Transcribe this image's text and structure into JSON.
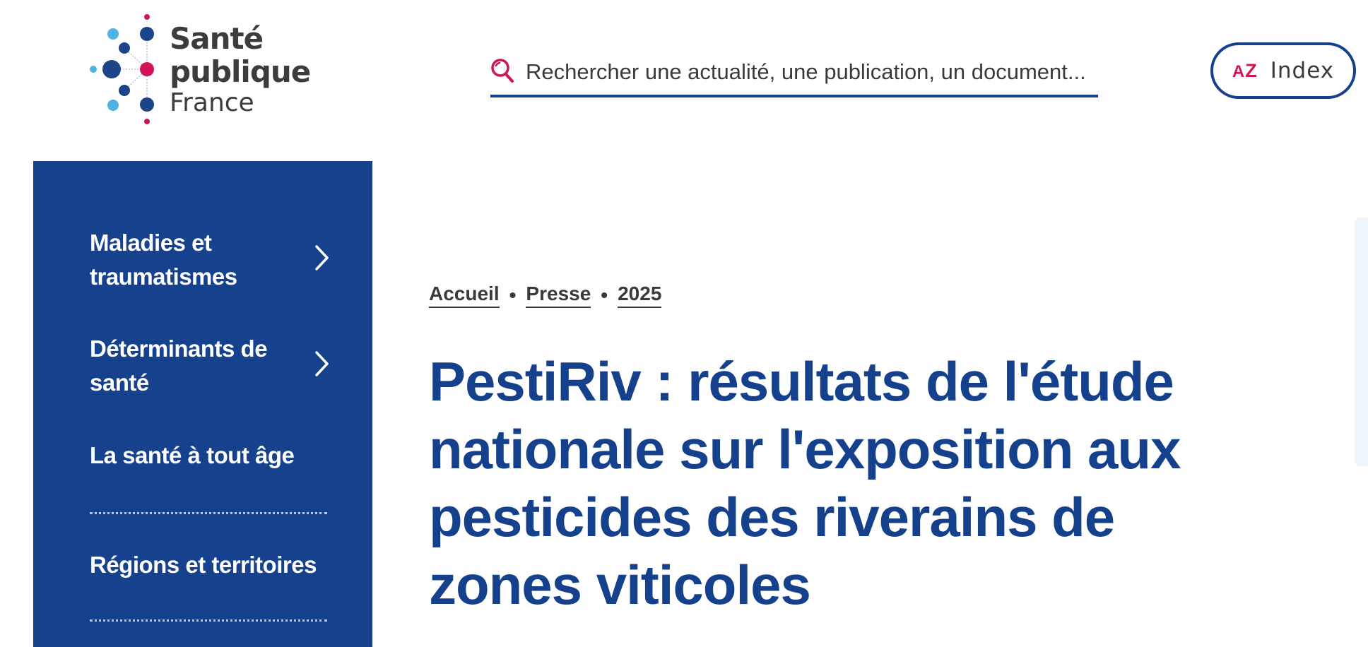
{
  "logo": {
    "line1": "Santé",
    "line2": "publique",
    "line3": "France",
    "colors": {
      "dark_blue": "#1d4389",
      "light_blue": "#4fb2e3",
      "pink": "#d1145a",
      "text": "#3c3c3b"
    }
  },
  "search": {
    "placeholder": "Rechercher une actualité, une publication, un document...",
    "icon": "search-icon"
  },
  "index_button": {
    "icon_text_a": "A",
    "icon_text_z": "Z",
    "label": "Index"
  },
  "sidebar": {
    "background": "#15418d",
    "items": [
      {
        "label": "Maladies et traumatismes",
        "has_chevron": true
      },
      {
        "label": "Déterminants de santé",
        "has_chevron": true
      },
      {
        "label": "La santé à tout âge",
        "has_chevron": false
      },
      {
        "label": "Régions et territoires",
        "has_chevron": false
      }
    ]
  },
  "breadcrumb": {
    "items": [
      "Accueil",
      "Presse",
      "2025"
    ],
    "separator": "•"
  },
  "page": {
    "title": "PestiRiv : résultats de l'étude nationale sur l'exposition aux pesticides des riverains de zones viticoles",
    "title_color": "#15408c"
  }
}
